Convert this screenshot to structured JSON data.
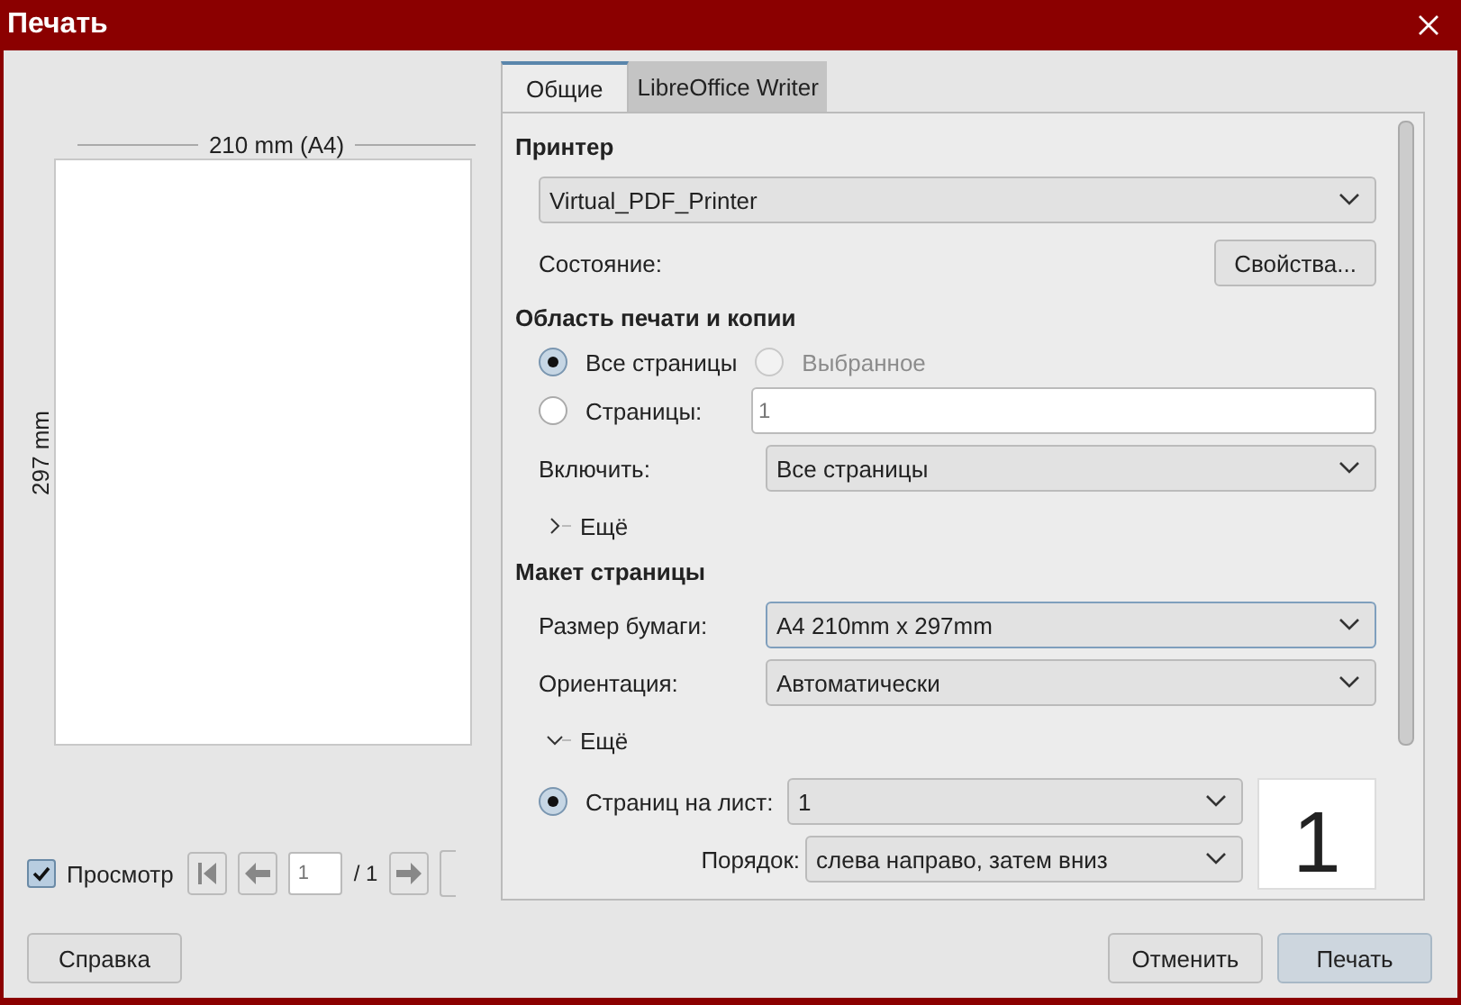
{
  "window": {
    "title": "Печать"
  },
  "preview": {
    "width_label": "210 mm (A4)",
    "height_label": "297 mm",
    "show": {
      "label": "Просмотр",
      "checked": true
    },
    "page_input": "1",
    "page_total": "/ 1"
  },
  "tabs": [
    {
      "label": "Общие",
      "selected": true
    },
    {
      "label": "LibreOffice Writer",
      "selected": false
    }
  ],
  "printer": {
    "heading": "Принтер",
    "selected_printer": "Virtual_PDF_Printer",
    "status_label": "Состояние:",
    "properties_button": "Свойства..."
  },
  "print_range": {
    "heading": "Область печати и копии",
    "options": [
      {
        "label": "Все страницы",
        "selected": true,
        "disabled": false
      },
      {
        "label": "Выбранное",
        "selected": false,
        "disabled": true
      },
      {
        "label": "Страницы:",
        "selected": false,
        "disabled": false
      }
    ],
    "pages_value": "1",
    "include_label": "Включить:",
    "include_value": "Все страницы",
    "more": {
      "label": "Ещё",
      "expanded": false
    }
  },
  "page_layout": {
    "heading": "Макет страницы",
    "paper_label": "Размер бумаги:",
    "paper_value": "A4 210mm x 297mm",
    "paper_focused": true,
    "orientation_label": "Ориентация:",
    "orientation_value": "Автоматически",
    "more": {
      "label": "Ещё",
      "expanded": true
    },
    "pages_per_sheet": {
      "label": "Страниц на лист:",
      "selected": true,
      "value": "1"
    },
    "order_label": "Порядок:",
    "order_value": "слева направо, затем вниз",
    "sheet_preview": "1"
  },
  "buttons": [
    {
      "label": "Справка",
      "kind": "normal"
    },
    {
      "label": "Отменить",
      "kind": "normal"
    },
    {
      "label": "Печать",
      "kind": "default"
    }
  ]
}
